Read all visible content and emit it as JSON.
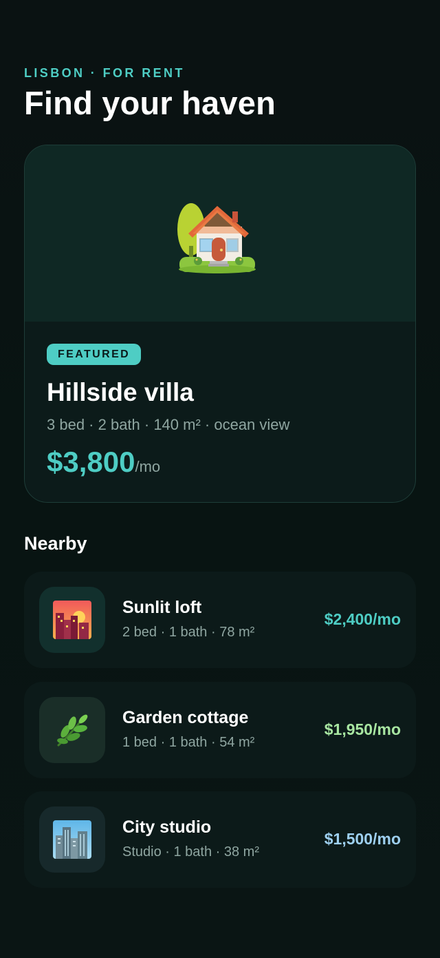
{
  "header": {
    "eyebrow": "LISBON · FOR RENT",
    "title": "Find your haven"
  },
  "featured": {
    "icon": "house-with-garden-icon",
    "badge": "FEATURED",
    "name": "Hillside villa",
    "meta": "3 bed · 2 bath · 140 m² · ocean view",
    "price": "$3,800",
    "price_unit": "/mo",
    "accent_color": "#4ecdc4"
  },
  "nearby": {
    "title": "Nearby",
    "items": [
      {
        "icon": "cityscape-at-dusk-icon",
        "name": "Sunlit loft",
        "meta": "2 bed · 1 bath · 78 m²",
        "price": "$2,400/mo",
        "price_color": "#4ecdc4",
        "thumb_color": "#12302d"
      },
      {
        "icon": "herb-icon",
        "name": "Garden cottage",
        "meta": "1 bed · 1 bath · 54 m²",
        "price": "$1,950/mo",
        "price_color": "#a8e6a1",
        "thumb_color": "#1a2e28"
      },
      {
        "icon": "cityscape-icon",
        "name": "City studio",
        "meta": "Studio · 1 bath · 38 m²",
        "price": "$1,500/mo",
        "price_color": "#9ed0f0",
        "thumb_color": "#17292b"
      }
    ]
  }
}
